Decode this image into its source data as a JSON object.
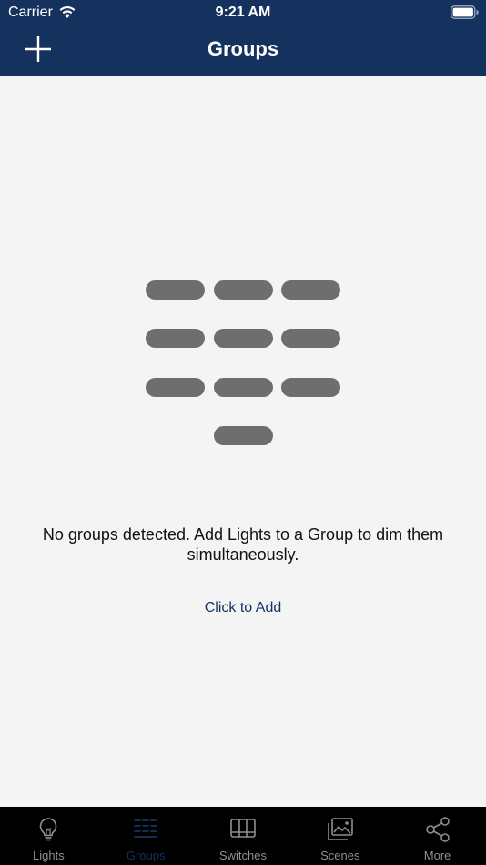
{
  "status_bar": {
    "carrier": "Carrier",
    "time": "9:21 AM",
    "wifi_icon": "wifi-icon",
    "battery_icon": "battery-icon"
  },
  "header": {
    "title": "Groups",
    "add_icon": "plus-icon"
  },
  "empty_state": {
    "message": "No groups detected. Add Lights to a Group to dim them simultaneously.",
    "action_label": "Click to Add"
  },
  "tabs": [
    {
      "label": "Lights",
      "icon": "lightbulb-icon",
      "active": false
    },
    {
      "label": "Groups",
      "icon": "groups-icon",
      "active": true
    },
    {
      "label": "Switches",
      "icon": "switches-icon",
      "active": false
    },
    {
      "label": "Scenes",
      "icon": "scenes-icon",
      "active": false
    },
    {
      "label": "More",
      "icon": "share-icon",
      "active": false
    }
  ],
  "colors": {
    "header_bg": "#15325e",
    "accent": "#15325e",
    "background": "#f4f4f4",
    "tab_bar_bg": "#000000",
    "tab_inactive": "#8e8e93",
    "pill": "#6e6e6e"
  }
}
